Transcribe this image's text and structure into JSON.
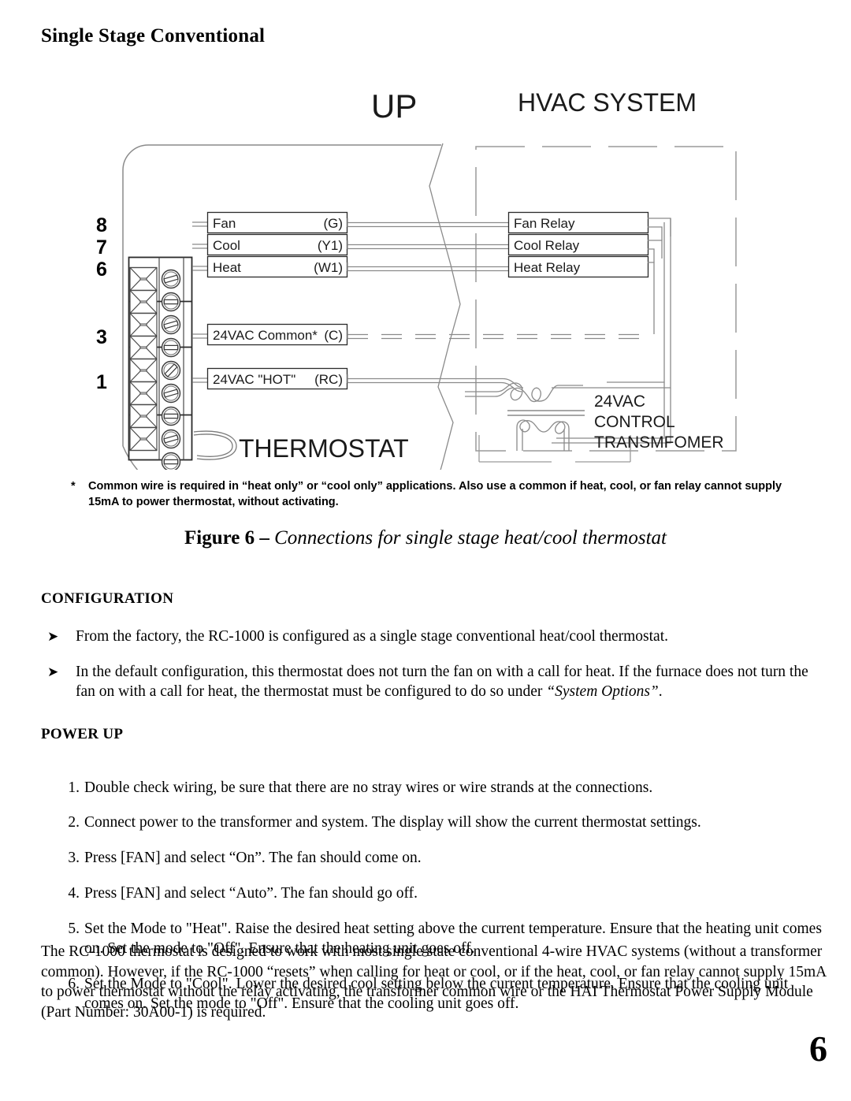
{
  "document": {
    "section_title": "Single Stage Conventional",
    "page_number": "6"
  },
  "diagram": {
    "up_label": "UP",
    "hvac_label": "HVAC SYSTEM",
    "thermostat_label": "THERMOSTAT",
    "transformer_label_lines": [
      "24VAC",
      "CONTROL",
      "TRANSMFOMER"
    ],
    "terminal_numbers": [
      "8",
      "7",
      "6",
      "3",
      "1"
    ],
    "wires": [
      {
        "name": "Fan",
        "code": "(G)",
        "relay": "Fan Relay",
        "dashed": false
      },
      {
        "name": "Cool",
        "code": "(Y1)",
        "relay": "Cool Relay",
        "dashed": false
      },
      {
        "name": "Heat",
        "code": "(W1)",
        "relay": "Heat Relay",
        "dashed": false
      },
      {
        "name": "24VAC Common*",
        "code": "(C)",
        "relay": "",
        "dashed": true
      },
      {
        "name": "24VAC \"HOT\"",
        "code": "(RC)",
        "relay": "",
        "dashed": false
      }
    ]
  },
  "footnote": {
    "marker": "*",
    "text": "Common wire is required in “heat only” or “cool only” applications.  Also use a common if heat, cool, or fan relay cannot supply 15mA to power thermostat, without activating."
  },
  "figure_caption": {
    "label": "Figure 6",
    "dash": " – ",
    "text": "Connections for single stage heat/cool thermostat"
  },
  "configuration": {
    "heading": "CONFIGURATION",
    "bullet_glyph": "➤",
    "items": [
      {
        "text": "From the factory, the RC-1000 is configured as a single stage conventional heat/cool thermostat.",
        "italic_tail": ""
      },
      {
        "text": "In the default configuration, this thermostat does not turn the fan on with a call for heat.  If the furnace does not turn the fan on with a call for heat, the thermostat must be configured to do so under ",
        "italic_tail": "“System Options”",
        "tail_after": "."
      }
    ]
  },
  "power_up": {
    "heading": "POWER UP",
    "steps": [
      {
        "num": "1.",
        "text": "Double check wiring, be sure that there are no stray wires or wire strands at the connections."
      },
      {
        "num": "2.",
        "text": "Connect power to the transformer and system.  The display will show the current thermostat settings."
      },
      {
        "num": "3.",
        "text": "Press [FAN] and select “On”.  The fan should come on."
      },
      {
        "num": "4.",
        "text": "Press [FAN] and select “Auto”.  The fan should go off."
      },
      {
        "num": "5.",
        "text": "Set the Mode to \"Heat\".  Raise the desired heat setting above the current temperature.  Ensure that the heating unit comes on.  Set the mode to \"Off\".  Ensure that the heating unit goes off."
      },
      {
        "num": "6.",
        "text": "Set the Mode to \"Cool\".  Lower the desired cool setting below the current temperature.  Ensure that the cooling unit comes on.  Set the mode to \"Off\".  Ensure that the cooling unit goes off."
      }
    ]
  },
  "closing_paragraph": "The RC-1000 thermostat is designed to work with most single state conventional 4-wire HVAC systems (without a transformer common).  However, if the RC-1000 “resets” when calling for heat or cool, or if the heat, cool, or fan relay cannot supply 15mA to power thermostat without the relay activating, the transformer common wire or the HAI Thermostat Power Supply Module (Part Number: 30A00-1) is required."
}
